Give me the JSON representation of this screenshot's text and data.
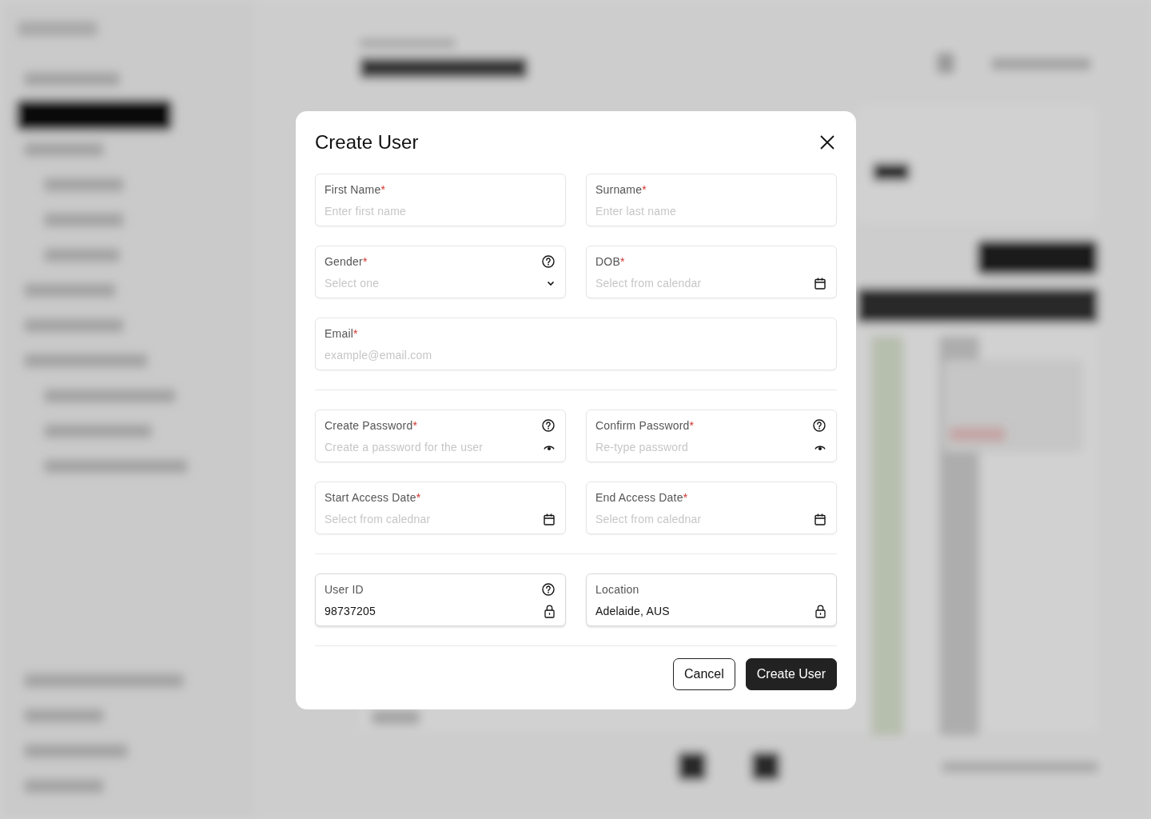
{
  "dialog": {
    "title": "Create User",
    "required_mark": "*",
    "sections": [
      {
        "rows": [
          [
            {
              "label": "First Name",
              "required": true,
              "kind": "text",
              "help": false,
              "placeholder": "Enter first name"
            },
            {
              "label": "Surname",
              "required": true,
              "kind": "text",
              "help": false,
              "placeholder": "Enter last name"
            }
          ],
          [
            {
              "label": "Gender",
              "required": true,
              "kind": "select",
              "help": true,
              "placeholder": "Select one"
            },
            {
              "label": "DOB",
              "required": true,
              "kind": "date",
              "help": false,
              "placeholder": "Select from calendar"
            }
          ],
          [
            {
              "label": "Email",
              "required": true,
              "kind": "text",
              "help": false,
              "placeholder": "example@email.com"
            }
          ]
        ]
      },
      {
        "rows": [
          [
            {
              "label": "Create Password",
              "required": true,
              "kind": "password",
              "help": true,
              "placeholder": "Create a password for the user"
            },
            {
              "label": "Confirm Password",
              "required": true,
              "kind": "password",
              "help": true,
              "placeholder": "Re-type password"
            }
          ],
          [
            {
              "label": "Start Access Date",
              "required": true,
              "kind": "date",
              "help": false,
              "placeholder": "Select from calednar"
            },
            {
              "label": "End Access Date",
              "required": true,
              "kind": "date",
              "help": false,
              "placeholder": "Select from calednar"
            }
          ]
        ]
      },
      {
        "rows": [
          [
            {
              "label": "User ID",
              "required": false,
              "kind": "locked",
              "help": true,
              "value": "98737205"
            },
            {
              "label": "Location",
              "required": false,
              "kind": "locked",
              "help": false,
              "value": "Adelaide, AUS"
            }
          ]
        ]
      }
    ],
    "buttons": [
      {
        "label": "Cancel",
        "kind": "secondary"
      },
      {
        "label": "Create User",
        "kind": "primary"
      }
    ]
  }
}
